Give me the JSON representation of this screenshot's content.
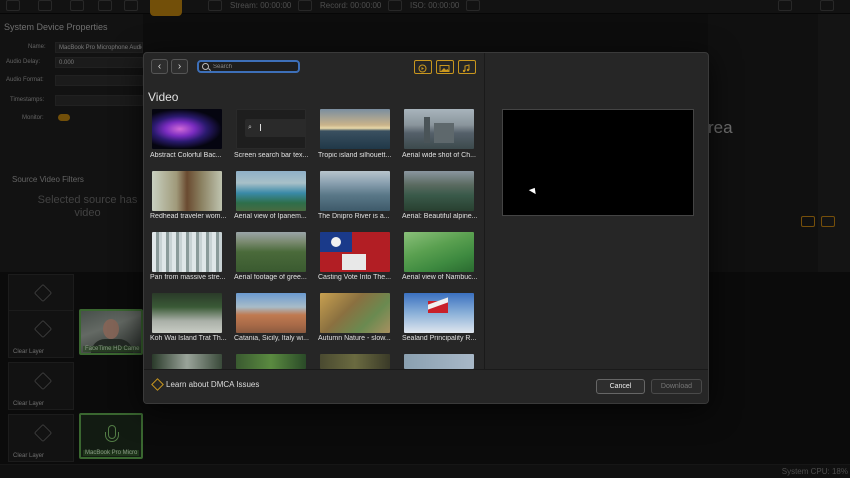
{
  "app": {
    "stream_label": "Stream: 00:00:00",
    "record_label": "Record: 00:00:00",
    "iso_label": "ISO: 00:00:00"
  },
  "left_panel": {
    "title": "System Device Properties",
    "name_label": "Name:",
    "name_value": "MacBook Pro Microphone Audio",
    "audio_delay_label": "Audio Delay:",
    "audio_delay_value": "0.000",
    "audio_format_label": "Audio Format:",
    "timestamps_label": "Timestamps:",
    "monitor_label": "Monitor:",
    "section_title": "Source Video Filters",
    "hint_text": "Selected source has video"
  },
  "preview_area_text": "rea",
  "layers": {
    "clear_label": "Clear Layer",
    "camera_label": "FaceTime HD Came",
    "mic_label": "MacBook Pro Micro"
  },
  "status": {
    "cpu_label": "System CPU:  18%"
  },
  "modal": {
    "search_placeholder": "Search",
    "section_title": "Video",
    "items": [
      {
        "caption": "Abstract Colorful Bac..."
      },
      {
        "caption": "Screen search bar tex..."
      },
      {
        "caption": "Tropic island silhouett..."
      },
      {
        "caption": "Aerial wide shot of Ch..."
      },
      {
        "caption": "Redhead traveler wom..."
      },
      {
        "caption": "Aerial view of Ipanem..."
      },
      {
        "caption": "The Dnipro River is a..."
      },
      {
        "caption": "Aerial: Beautiful alpine..."
      },
      {
        "caption": "Pan from massive stre..."
      },
      {
        "caption": "Aerial footage of gree..."
      },
      {
        "caption": "Casting Vote Into The..."
      },
      {
        "caption": "Aerial view of Nambuc..."
      },
      {
        "caption": "Koh Wai Island Trat Th..."
      },
      {
        "caption": "Catania, Sicily, Italy wi..."
      },
      {
        "caption": "Autumn Nature - slow..."
      },
      {
        "caption": "Sealand Principality R..."
      }
    ],
    "dmca_text": "Learn about DMCA Issues",
    "cancel_label": "Cancel",
    "download_label": "Download"
  }
}
